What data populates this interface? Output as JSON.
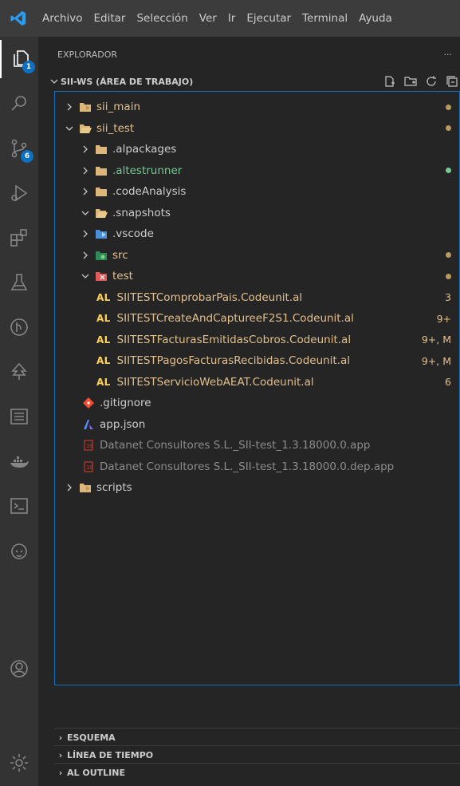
{
  "menu": [
    "Archivo",
    "Editar",
    "Selección",
    "Ver",
    "Ir",
    "Ejecutar",
    "Terminal",
    "Ayuda"
  ],
  "activity_bar": {
    "explorer_badge": "1",
    "scm_badge": "6"
  },
  "sidebar": {
    "title": "EXPLORADOR",
    "more": "···",
    "workspace": "SII-WS (ÁREA DE TRABAJO)",
    "tree": [
      {
        "label": "sii_main",
        "chevron": "›",
        "icon": "folder-vscode-icon",
        "color": "yellow",
        "trail": "dot"
      },
      {
        "label": "sii_test",
        "chevron": "⌄",
        "icon": "folder-vscode-open-icon",
        "color": "yellow",
        "trail": "dot"
      },
      {
        "label": ".alpackages",
        "chevron": "›",
        "icon": "folder-icon",
        "color": "white",
        "trail": ""
      },
      {
        "label": ".altestrunner",
        "chevron": "›",
        "icon": "folder-icon",
        "color": "green",
        "trail": "dot"
      },
      {
        "label": ".codeAnalysis",
        "chevron": "›",
        "icon": "folder-icon",
        "color": "white",
        "trail": ""
      },
      {
        "label": ".snapshots",
        "chevron": "⌄",
        "icon": "folder-open-icon",
        "color": "white",
        "trail": ""
      },
      {
        "label": ".vscode",
        "chevron": "›",
        "icon": "folder-vscode-blue-icon",
        "color": "white",
        "trail": ""
      },
      {
        "label": "src",
        "chevron": "›",
        "icon": "folder-src-icon",
        "color": "yellow",
        "trail": "dot"
      },
      {
        "label": "test",
        "chevron": "⌄",
        "icon": "folder-test-icon",
        "color": "yellow",
        "trail": "dot"
      },
      {
        "label": "SIITESTComprobarPais.Codeunit.al",
        "al": "AL",
        "color": "yellow",
        "trail": "3"
      },
      {
        "label": "SIITESTCreateAndCaptureeF2S1.Codeunit.al",
        "al": "AL",
        "color": "yellow",
        "trail": "9+"
      },
      {
        "label": "SIITESTFacturasEmitidasCobros.Codeunit.al",
        "al": "AL",
        "color": "yellow",
        "trail": "9+, M"
      },
      {
        "label": "SIITESTPagosFacturasRecibidas.Codeunit.al",
        "al": "AL",
        "color": "yellow",
        "trail": "9+, M"
      },
      {
        "label": "SIITESTServicioWebAEAT.Codeunit.al",
        "al": "AL",
        "color": "yellow",
        "trail": "6"
      },
      {
        "label": ".gitignore",
        "icon": "git-icon",
        "color": "white",
        "trail": ""
      },
      {
        "label": "app.json",
        "icon": "al-app-json-icon",
        "color": "white",
        "trail": ""
      },
      {
        "label": "Datanet Consultores S.L._SII-test_1.3.18000.0.app",
        "icon": "binary-file-icon",
        "color": "gray",
        "trail": ""
      },
      {
        "label": "Datanet Consultores S.L._SII-test_1.3.18000.0.dep.app",
        "icon": "binary-file-icon",
        "color": "gray",
        "trail": ""
      },
      {
        "label": "scripts",
        "chevron": "›",
        "icon": "folder-vscode-icon",
        "color": "white",
        "trail": ""
      }
    ],
    "sections": [
      "ESQUEMA",
      "LÍNEA DE TIEMPO",
      "AL OUTLINE"
    ]
  },
  "colors": {
    "accent": "#0e70c0",
    "modified": "#e2c08d",
    "untracked": "#73c991",
    "al_keyword": "#ffd35b"
  }
}
